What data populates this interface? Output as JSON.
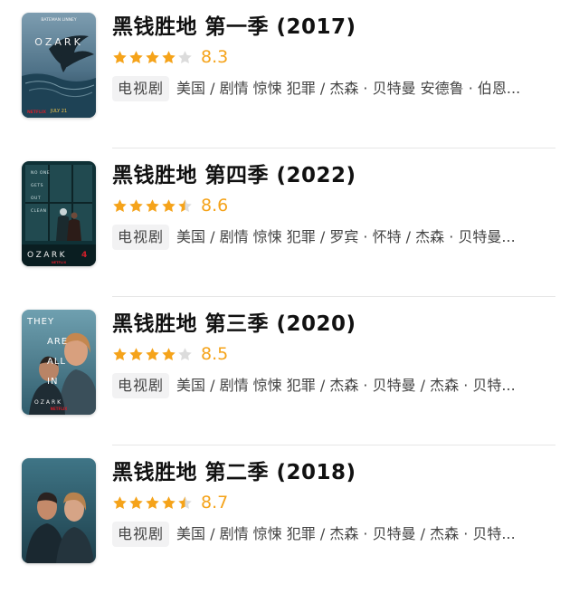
{
  "colors": {
    "star_filled": "#f5a31a",
    "star_empty": "#dcdcdc",
    "score": "#f5a31a",
    "tag_bg": "#f2f2f3"
  },
  "items": [
    {
      "title": "黑钱胜地 第一季 (2017)",
      "rating": {
        "stars": 4,
        "score": "8.3"
      },
      "tag": "电视剧",
      "info": "美国 / 剧情 惊悚 犯罪 / 杰森 · 贝特曼 安德鲁 · 伯恩...",
      "poster": {
        "icon": "ozark-season-1-poster",
        "wordmark": "OZARK",
        "top_text": "BATEMAN  LINNEY",
        "date": "JULY 21",
        "brand": "NETFLIX",
        "colors": {
          "sky": "#5f7f93",
          "water": "#23465a",
          "accent": "#d11f2a"
        }
      }
    },
    {
      "title": "黑钱胜地 第四季 (2022)",
      "rating": {
        "stars": 4.5,
        "score": "8.6"
      },
      "tag": "电视剧",
      "info": "美国 / 剧情 惊悚 犯罪 / 罗宾 · 怀特 / 杰森 · 贝特曼...",
      "poster": {
        "icon": "ozark-season-4-poster",
        "wordmark": "OZARK",
        "season": "4",
        "panel_lines": [
          "NO ONE",
          "GETS",
          "OUT",
          "CLEAN"
        ],
        "brand": "NETFLIX",
        "colors": {
          "bg": "#0f3136",
          "window": "#3c6b70",
          "accent": "#d11f2a"
        }
      }
    },
    {
      "title": "黑钱胜地 第三季 (2020)",
      "rating": {
        "stars": 4,
        "score": "8.5"
      },
      "tag": "电视剧",
      "info": "美国 / 剧情 惊悚 犯罪 / 杰森 · 贝特曼 / 杰森 · 贝特...",
      "poster": {
        "icon": "ozark-season-3-poster",
        "wordmark": "OZARK",
        "big_lines": [
          "THEY",
          "ARE",
          "ALL",
          "IN"
        ],
        "brand": "NETFLIX",
        "colors": {
          "bg": "#4f8294",
          "skin": "#d9a080",
          "accent": "#d11f2a"
        }
      }
    },
    {
      "title": "黑钱胜地 第二季 (2018)",
      "rating": {
        "stars": 4.5,
        "score": "8.7"
      },
      "tag": "电视剧",
      "info": "美国 / 剧情 惊悚 犯罪 / 杰森 · 贝特曼 / 杰森 · 贝特...",
      "poster": {
        "icon": "ozark-season-2-poster",
        "colors": {
          "bg": "#2f6272",
          "skin": "#c98c6c",
          "dark": "#1c2b33"
        }
      }
    }
  ]
}
